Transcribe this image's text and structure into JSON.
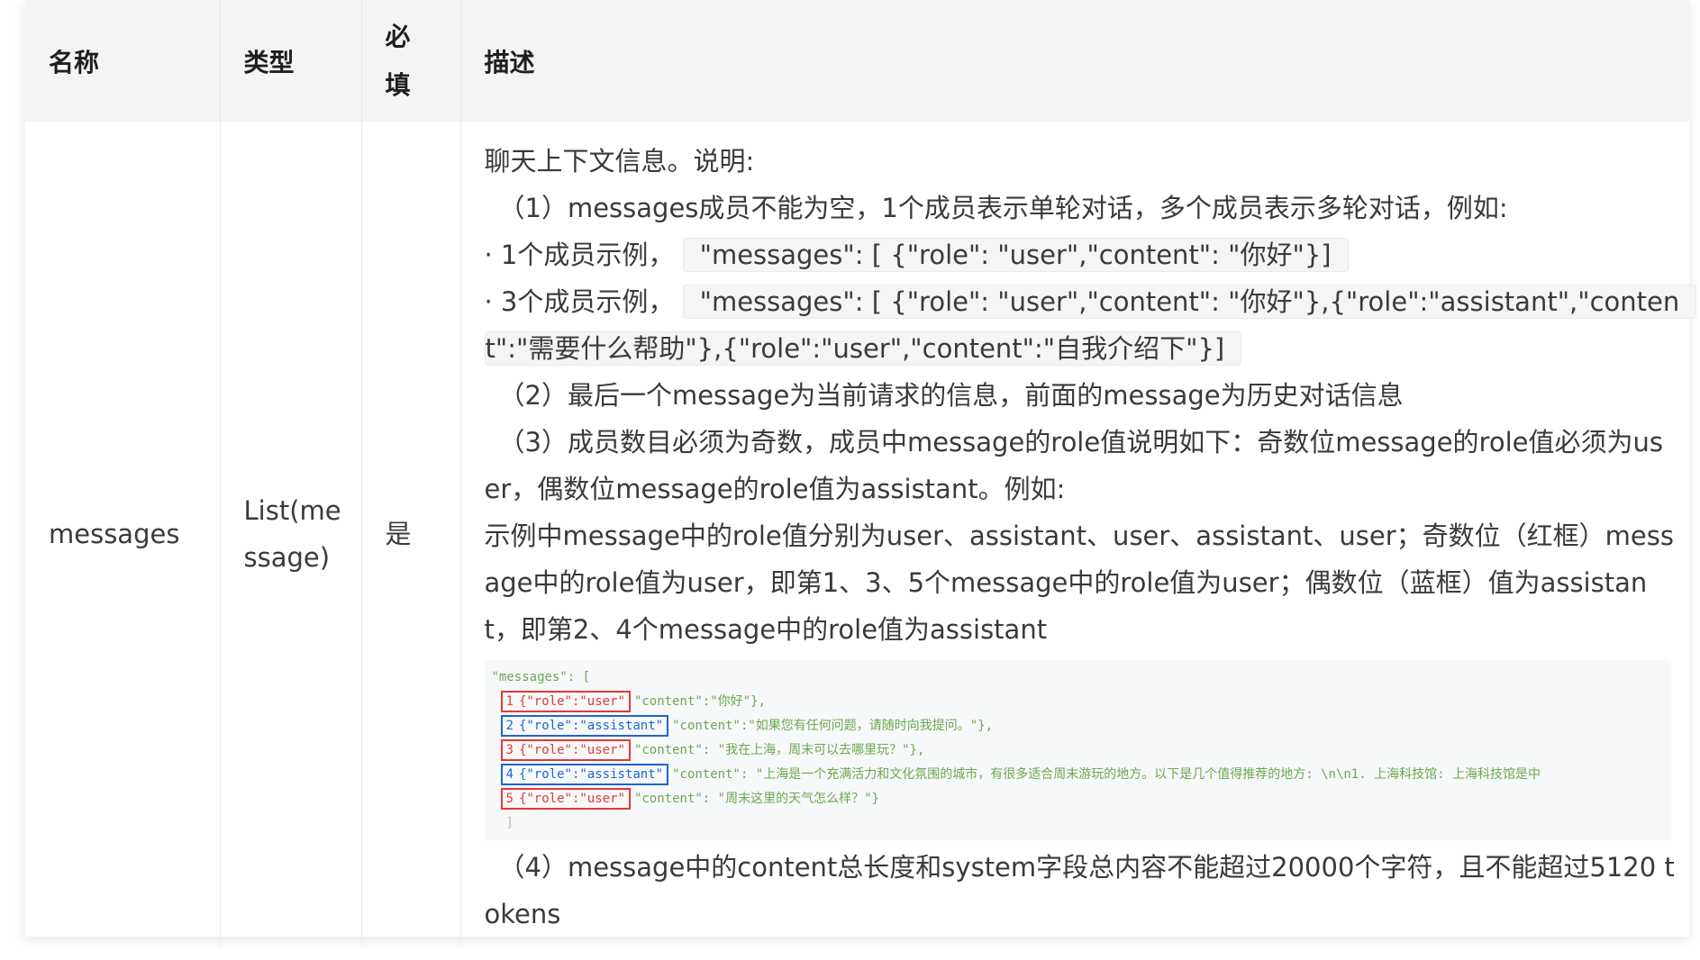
{
  "table": {
    "headers": {
      "name": "名称",
      "type": "类型",
      "required_line1": "必",
      "required_line2": "填",
      "description": "描述"
    },
    "row": {
      "name": "messages",
      "type_line1": "List(me",
      "type_line2": "ssage)",
      "required": "是",
      "desc": {
        "l1": "聊天上下文信息。说明:",
        "l2": "（1）messages成员不能为空，1个成员表示单轮对话，多个成员表示多轮对话，例如:",
        "l3_prefix": "· 1个成员示例，",
        "l3_code": "\"messages\": [ {\"role\": \"user\",\"content\": \"你好\"}]",
        "l4_prefix": "· 3个成员示例，",
        "l4_code": "\"messages\": [ {\"role\": \"user\",\"content\": \"你好\"},{\"role\":\"assistant\",\"conten",
        "l5_code": "t\":\"需要什么帮助\"},{\"role\":\"user\",\"content\":\"自我介绍下\"}]",
        "l6": "（2）最后一个message为当前请求的信息，前面的message为历史对话信息",
        "l7": "（3）成员数目必须为奇数，成员中message的role值说明如下：奇数位message的role值必须为us",
        "l8": "er，偶数位message的role值为assistant。例如:",
        "l9": "示例中message中的role值分别为user、assistant、user、assistant、user；奇数位（红框）mess",
        "l10": "age中的role值为user，即第1、3、5个message中的role值为user；偶数位（蓝框）值为assistan",
        "l11": "t，即第2、4个message中的role值为assistant",
        "code_image": {
          "header": "\"messages\": [",
          "rows": [
            {
              "num": "1",
              "role": "{\"role\":\"user\"",
              "content": "\"content\":\"你好\"},",
              "color": "red"
            },
            {
              "num": "2",
              "role": "{\"role\":\"assistant\"",
              "content": "\"content\":\"如果您有任何问题，请随时向我提问。\"},",
              "color": "blue"
            },
            {
              "num": "3",
              "role": "{\"role\":\"user\"",
              "content": "\"content\": \"我在上海，周末可以去哪里玩？\"},",
              "color": "red"
            },
            {
              "num": "4",
              "role": "{\"role\":\"assistant\"",
              "content": "\"content\": \"上海是一个充满活力和文化氛围的城市，有很多适合周末游玩的地方。以下是几个值得推荐的地方: \\n\\n1. 上海科技馆: 上海科技馆是中",
              "color": "blue"
            },
            {
              "num": "5",
              "role": "{\"role\":\"user\"",
              "content": "\"content\": \"周末这里的天气怎么样？\"}",
              "color": "red"
            }
          ],
          "footer": "]"
        },
        "l12": "（4）message中的content总长度和system字段总内容不能超过20000个字符，且不能超过5120 t",
        "l13": "okens"
      }
    }
  },
  "colors": {
    "header_bg": "#f3f4f6",
    "red_box": "#e53935",
    "blue_box": "#1e66d0",
    "code_green": "#6aa84f"
  }
}
